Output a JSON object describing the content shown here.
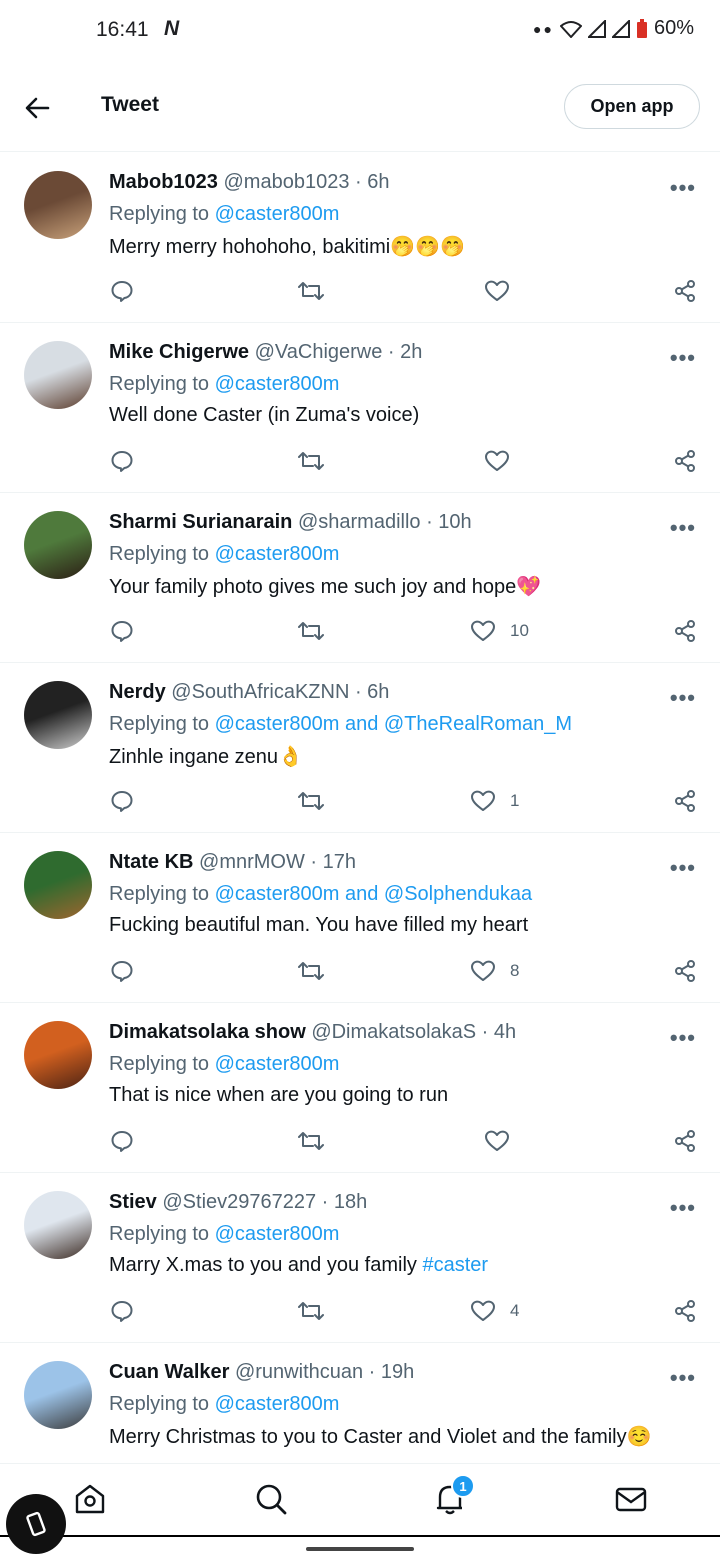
{
  "status_bar": {
    "time": "16:41",
    "n_logo": "N",
    "battery": "60%"
  },
  "header": {
    "back_icon": "arrow-left-icon",
    "title": "Tweet",
    "open_app": "Open app"
  },
  "tweets": [
    {
      "name": "Mabob1023",
      "meta": "@mabob1023 · 6h",
      "reply_prefix": "Replying to",
      "reply_handles": "@caster800m",
      "text": "Merry merry hohohoho, bakitimi",
      "emojis": "🤭🤭🤭",
      "hashtag": "",
      "likes": "",
      "avatar_colors": [
        "#6b4a36",
        "#c9a27b"
      ]
    },
    {
      "name": "Mike Chigerwe",
      "meta": "@VaChigerwe · 2h",
      "reply_prefix": "Replying to",
      "reply_handles": "@caster800m",
      "text": "Well done Caster (in Zuma's voice)",
      "emojis": "",
      "hashtag": "",
      "likes": "",
      "avatar_colors": [
        "#d7dde3",
        "#5a3b2b"
      ]
    },
    {
      "name": "Sharmi Surianarain",
      "meta": "@sharmadillo · 10h",
      "reply_prefix": "Replying to",
      "reply_handles": "@caster800m",
      "text": "Your family photo gives me such joy and hope",
      "emojis": "💖",
      "hashtag": "",
      "likes": "10",
      "avatar_colors": [
        "#4f7a3c",
        "#2b1c14"
      ]
    },
    {
      "name": "Nerdy",
      "meta": "@SouthAfricaKZNN · 6h",
      "reply_prefix": "Replying to",
      "reply_handles": "@caster800m and @TheRealRoman_M",
      "text": "Zinhle ingane zenu",
      "emojis": "👌",
      "hashtag": "",
      "likes": "1",
      "avatar_colors": [
        "#222222",
        "#cfcfcf"
      ]
    },
    {
      "name": "Ntate KB",
      "meta": "@mnrMOW · 17h",
      "reply_prefix": "Replying to",
      "reply_handles": "@caster800m and @Solphendukaa",
      "text": "Fucking beautiful man. You have filled my heart",
      "emojis": "",
      "hashtag": "",
      "likes": "8",
      "avatar_colors": [
        "#2f6b2f",
        "#a0652f"
      ]
    },
    {
      "name": "Dimakatsolaka show",
      "meta": "@DimakatsolakaS · 4h",
      "reply_prefix": "Replying to",
      "reply_handles": "@caster800m",
      "text": "That is nice when are you going to run",
      "emojis": "",
      "hashtag": "",
      "likes": "",
      "avatar_colors": [
        "#d2601f",
        "#4a2214"
      ]
    },
    {
      "name": "Stiev",
      "meta": "@Stiev29767227 · 18h",
      "reply_prefix": "Replying to",
      "reply_handles": "@caster800m",
      "text": "Marry X.mas to you and you family ",
      "emojis": "",
      "hashtag": "#caster",
      "likes": "4",
      "avatar_colors": [
        "#dfe6ee",
        "#3b2a22"
      ]
    },
    {
      "name": "Cuan Walker",
      "meta": "@runwithcuan · 19h",
      "reply_prefix": "Replying to",
      "reply_handles": "@caster800m",
      "text": "Merry Christmas to you to Caster and Violet and the family",
      "emojis": "☺️",
      "hashtag": "",
      "likes": "",
      "avatar_colors": [
        "#9cc3e8",
        "#3a3a3a"
      ]
    }
  ],
  "bottom_nav": {
    "notification_count": "1"
  }
}
